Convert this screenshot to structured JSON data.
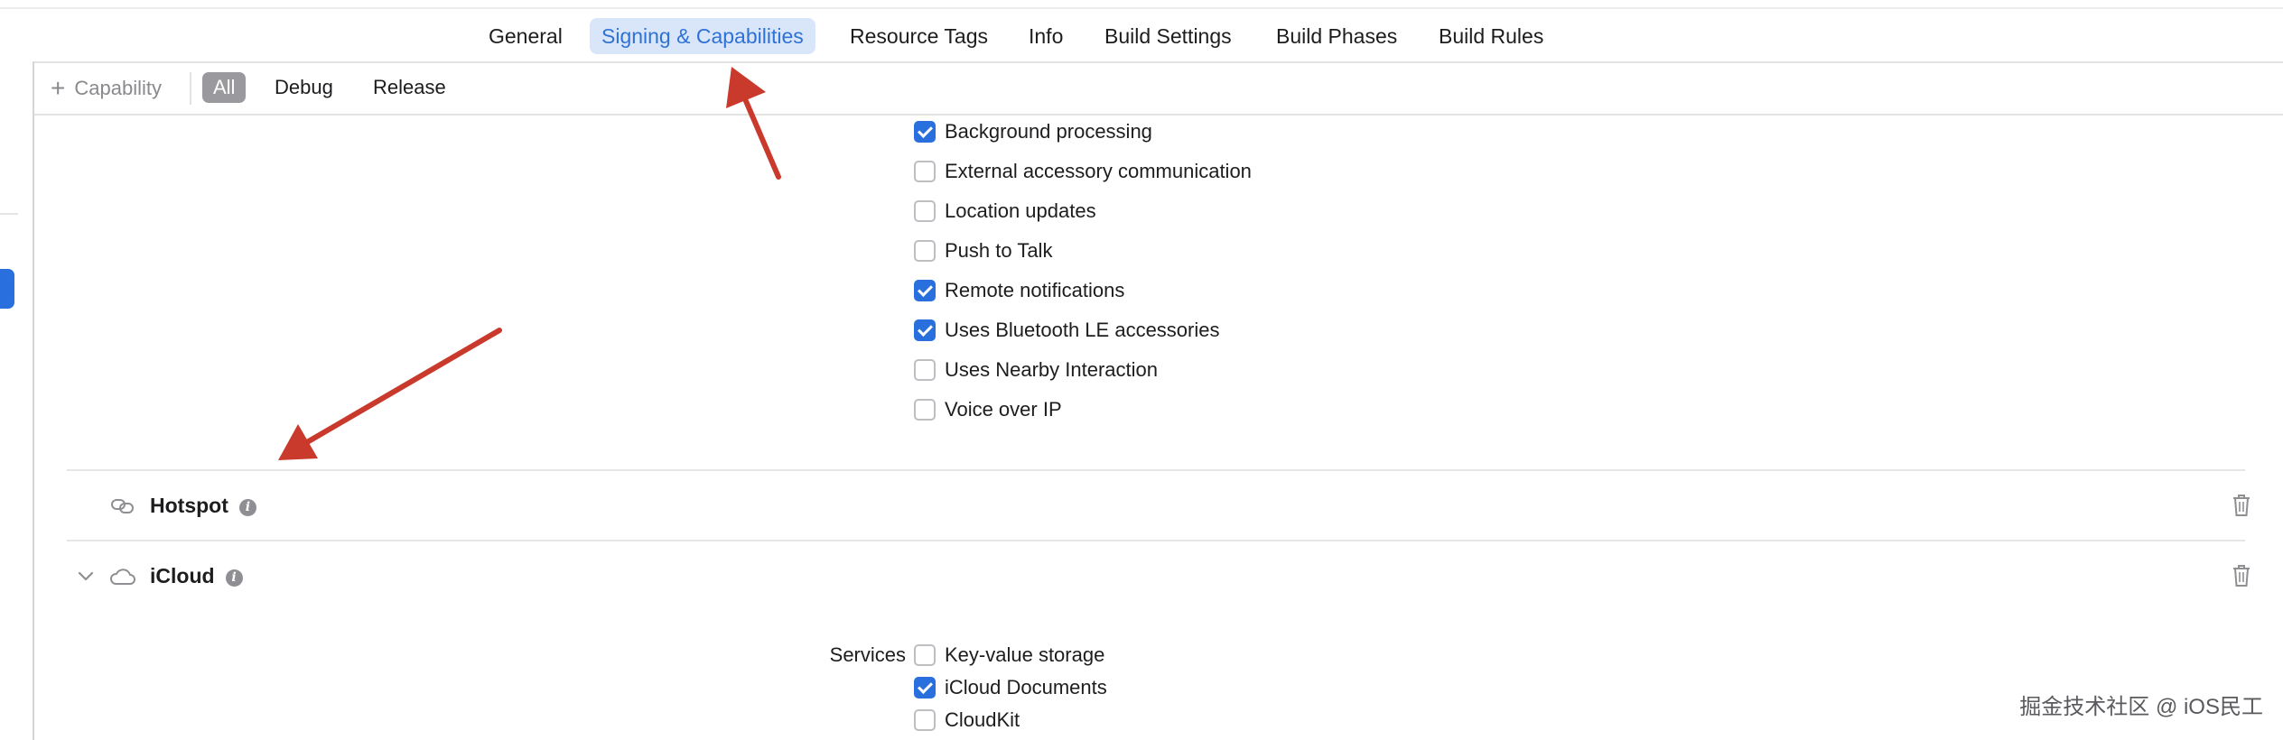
{
  "tabs": [
    {
      "label": "General"
    },
    {
      "label": "Signing & Capabilities",
      "active": true
    },
    {
      "label": "Resource Tags"
    },
    {
      "label": "Info"
    },
    {
      "label": "Build Settings"
    },
    {
      "label": "Build Phases"
    },
    {
      "label": "Build Rules"
    }
  ],
  "filter": {
    "add_capability_label": "Capability",
    "segments": [
      {
        "label": "All",
        "active": true
      },
      {
        "label": "Debug"
      },
      {
        "label": "Release"
      }
    ]
  },
  "background_modes": {
    "items": [
      {
        "label": "Background processing",
        "checked": true
      },
      {
        "label": "External accessory communication",
        "checked": false
      },
      {
        "label": "Location updates",
        "checked": false
      },
      {
        "label": "Push to Talk",
        "checked": false
      },
      {
        "label": "Remote notifications",
        "checked": true
      },
      {
        "label": "Uses Bluetooth LE accessories",
        "checked": true
      },
      {
        "label": "Uses Nearby Interaction",
        "checked": false
      },
      {
        "label": "Voice over IP",
        "checked": false
      }
    ]
  },
  "hotspot": {
    "title": "Hotspot",
    "icon": "link-icon"
  },
  "icloud": {
    "title": "iCloud",
    "icon": "cloud-icon",
    "services_label": "Services",
    "services": [
      {
        "label": "Key-value storage",
        "checked": false
      },
      {
        "label": "iCloud Documents",
        "checked": true
      },
      {
        "label": "CloudKit",
        "checked": false
      }
    ]
  },
  "watermark": "掘金技术社区 @ iOS民工",
  "colors": {
    "accent": "#2a6fde",
    "active_tab_bg": "#d9e6f9",
    "annotation_arrow": "#c93a2c"
  }
}
